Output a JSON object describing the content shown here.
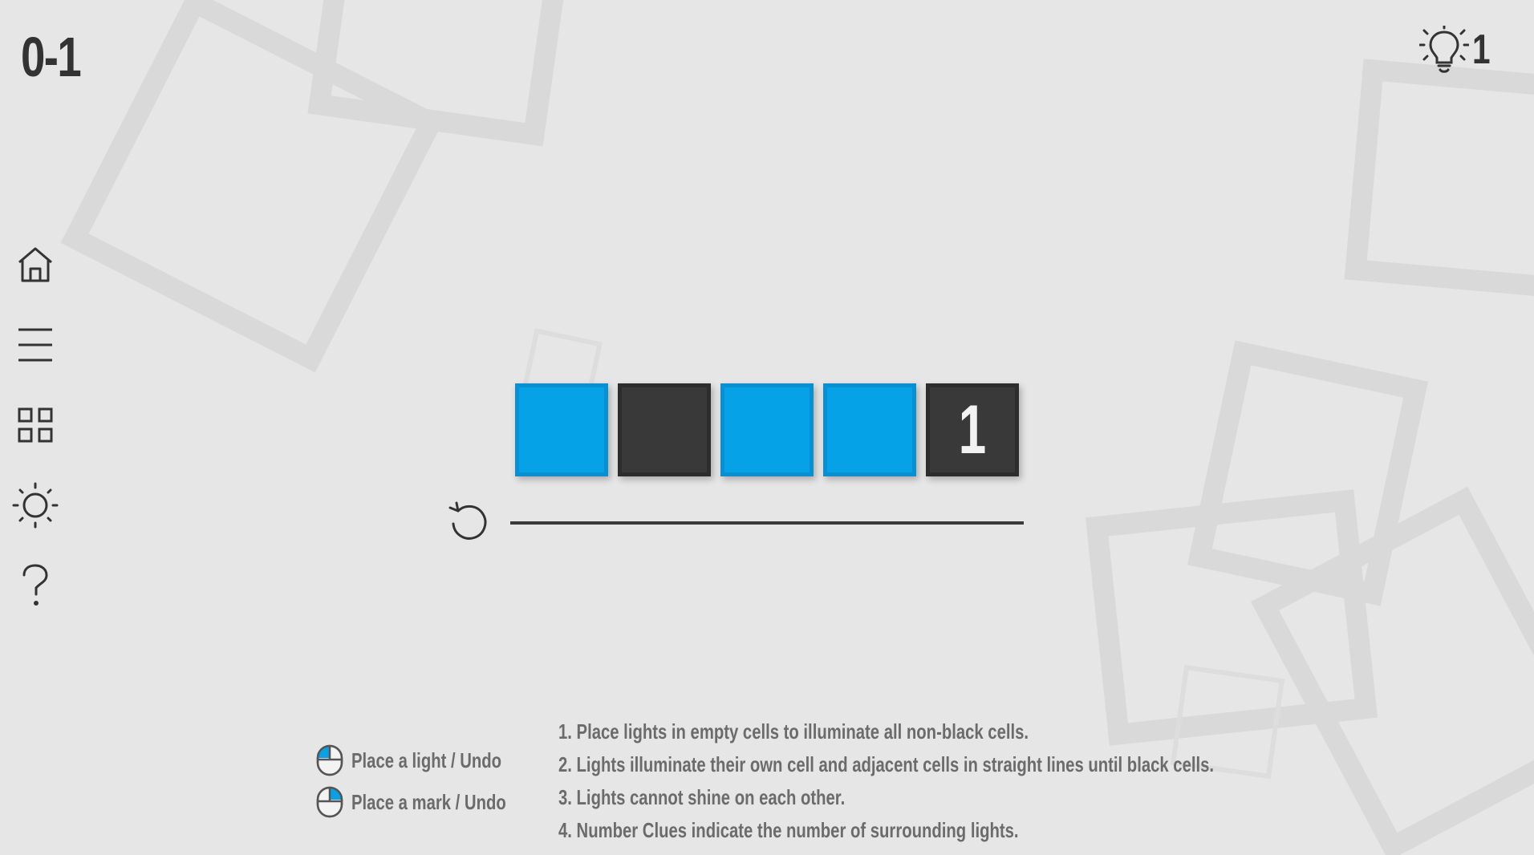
{
  "level": {
    "title": "0-1"
  },
  "hints": {
    "icon": "lightbulb-icon",
    "count": "1"
  },
  "sidebar": {
    "items": [
      {
        "name": "home",
        "icon": "home-icon"
      },
      {
        "name": "menu",
        "icon": "menu-icon"
      },
      {
        "name": "levels",
        "icon": "grid-icon"
      },
      {
        "name": "theme",
        "icon": "sun-icon"
      },
      {
        "name": "help",
        "icon": "help-icon"
      }
    ]
  },
  "board": {
    "rows": 1,
    "cols": 5,
    "cells": [
      {
        "type": "lit",
        "clue": ""
      },
      {
        "type": "black",
        "clue": ""
      },
      {
        "type": "lit",
        "clue": ""
      },
      {
        "type": "lit",
        "clue": ""
      },
      {
        "type": "black",
        "clue": "1"
      }
    ]
  },
  "progress": {
    "fraction": 1.0
  },
  "controls": {
    "left_click": "Place a light / Undo",
    "right_click": "Place a mark / Undo"
  },
  "rules": [
    "1. Place lights in empty cells to illuminate all non-black cells.",
    "2. Lights illuminate their own cell and adjacent cells in straight lines until black cells.",
    "3. Lights cannot shine on each other.",
    "4. Number Clues indicate the number of surrounding lights."
  ],
  "colors": {
    "background": "#e6e6e6",
    "lit_cell": "#06a2e8",
    "black_cell": "#393939",
    "text_dark": "#333333",
    "text_muted": "#6b6b6b"
  }
}
